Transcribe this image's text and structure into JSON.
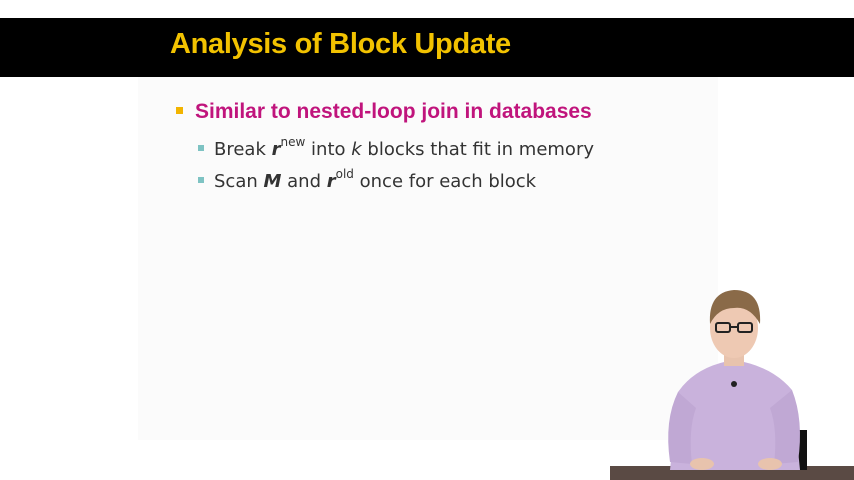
{
  "slide": {
    "title": "Analysis of Block Update",
    "bullet": "Similar to nested-loop join in databases",
    "sub1": {
      "prefix": "Break ",
      "var_r": "r",
      "sup_new": "new",
      "middle": " into ",
      "var_k": "k",
      "suffix": " blocks that fit in memory"
    },
    "sub2": {
      "prefix": "Scan ",
      "var_M": "M",
      "and": " and ",
      "var_r": "r",
      "sup_old": "old",
      "suffix": " once for each block"
    }
  },
  "colors": {
    "title_text": "#f2c200",
    "bullet_text": "#c0147c",
    "level1_marker": "#f2b400",
    "level2_marker": "#7ec3c3"
  }
}
